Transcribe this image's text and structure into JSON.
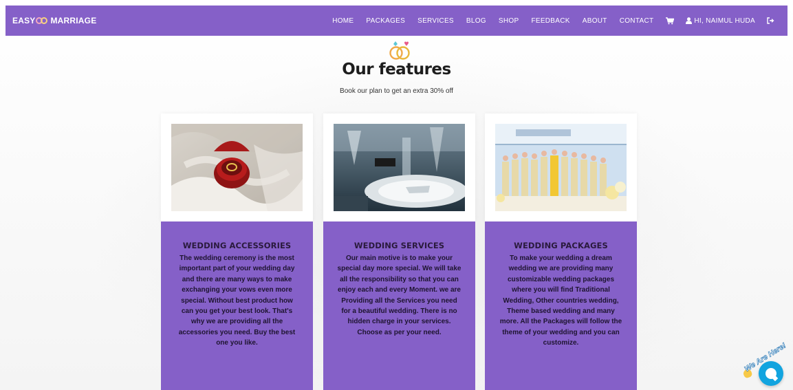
{
  "navbar": {
    "brand_left": "EASY",
    "brand_right": "MARRIAGE",
    "links": [
      "HOME",
      "PACKAGES",
      "SERVICES",
      "BLOG",
      "SHOP",
      "FEEDBACK",
      "ABOUT",
      "CONTACT"
    ],
    "user_label": "HI, NAIMUL HUDA",
    "icons": {
      "cart": "cart-icon",
      "user": "user-icon",
      "logout": "logout-icon"
    },
    "color": "#8560c8"
  },
  "features": {
    "title": "Our features",
    "subtitle": "Book our plan to get an extra 30% off",
    "cards": [
      {
        "title": "WEDDING ACCESSORIES",
        "text": "The wedding ceremony is the most important part of your wedding day and there are many ways to make exchanging your vows even more special. Without best product how can you get your best look. That's why we are providing all the accessories you need. Buy the best one you like.",
        "image": "ring-box-photo"
      },
      {
        "title": "WEDDING SERVICES",
        "text": "Our main motive is to make your special day more special. We will take all the responsibility so that you can enjoy each and every Moment. we are Providing all the Services you need for a beautiful wedding. There is no hidden charge in your services. Choose as per your need.",
        "image": "table-setting-photo"
      },
      {
        "title": "WEDDING PACKAGES",
        "text": "To make your wedding a dream wedding we are providing many customizable wedding packages where you will find Traditional Wedding, Other countries wedding, Theme based wedding and many more. All the Packages will follow the theme of your wedding and you can customize.",
        "image": "wedding-party-photo"
      }
    ]
  },
  "chat_widget": {
    "label": "We Are Here!",
    "color": "#12a4df"
  }
}
